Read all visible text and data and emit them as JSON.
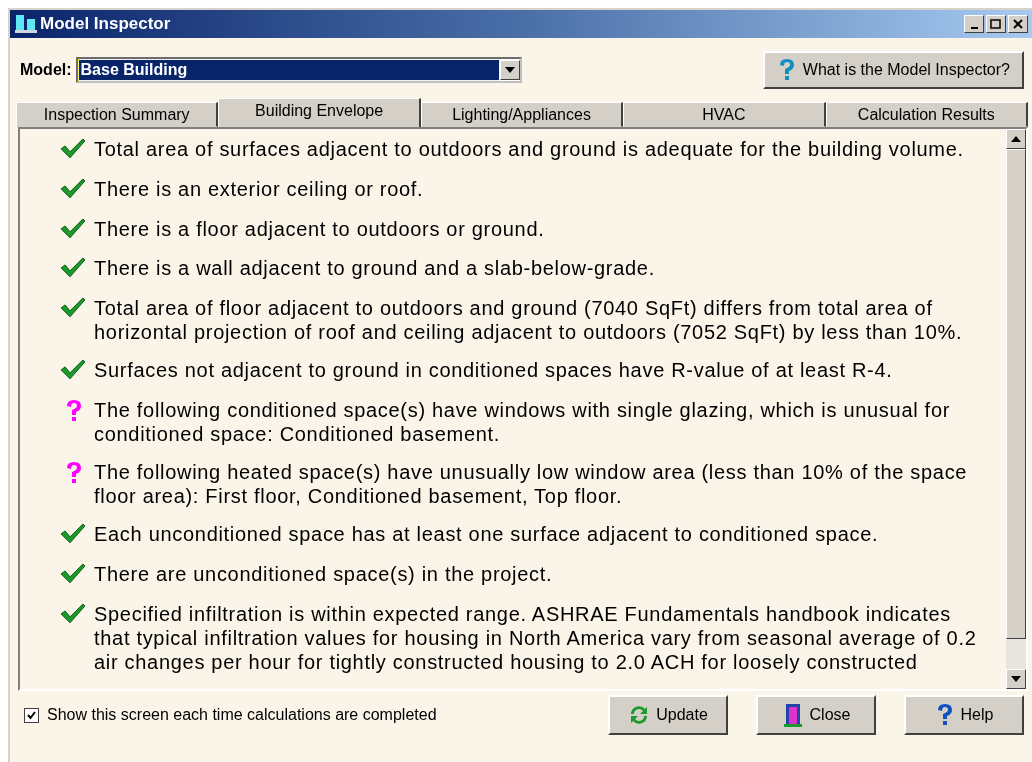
{
  "window": {
    "title": "Model Inspector"
  },
  "model": {
    "label": "Model:",
    "value": "Base Building"
  },
  "help_top_button": "What is the Model Inspector?",
  "tabs": [
    {
      "label": "Inspection Summary",
      "selected": false
    },
    {
      "label": "Building Envelope",
      "selected": true
    },
    {
      "label": "Lighting/Appliances",
      "selected": false
    },
    {
      "label": "HVAC",
      "selected": false
    },
    {
      "label": "Calculation Results",
      "selected": false
    }
  ],
  "findings": [
    {
      "kind": "pass",
      "text": "Total area of surfaces adjacent to outdoors and ground is adequate for the building volume."
    },
    {
      "kind": "pass",
      "text": "There is an exterior ceiling or roof."
    },
    {
      "kind": "pass",
      "text": "There is a floor adjacent to outdoors or ground."
    },
    {
      "kind": "pass",
      "text": "There is a wall adjacent to ground and a slab-below-grade."
    },
    {
      "kind": "pass",
      "text": "Total area of floor adjacent to outdoors and ground (7040 SqFt) differs from total area of horizontal projection of roof and ceiling adjacent to outdoors (7052 SqFt) by less than 10%."
    },
    {
      "kind": "pass",
      "text": "Surfaces not adjacent to ground in conditioned spaces have R-value of at least R-4."
    },
    {
      "kind": "question",
      "text": "The following conditioned space(s) have windows with single glazing, which is unusual for conditioned space: Conditioned basement."
    },
    {
      "kind": "question",
      "text": "The following heated space(s) have unusually low window area (less than 10% of the space floor area): First floor, Conditioned basement, Top floor."
    },
    {
      "kind": "pass",
      "text": "Each unconditioned space has at least one surface adjacent to conditioned space."
    },
    {
      "kind": "pass",
      "text": "There are unconditioned space(s) in the project."
    },
    {
      "kind": "pass",
      "text": "Specified infiltration is within expected range. ASHRAE Fundamentals handbook indicates that typical infiltration values for housing in North America vary from seasonal average of 0.2 air changes per hour for tightly constructed housing to 2.0 ACH for loosely constructed"
    }
  ],
  "show_each_time": {
    "label": "Show this screen each time calculations are completed",
    "checked": true
  },
  "buttons": [
    {
      "kind": "update",
      "label": "Update"
    },
    {
      "kind": "close",
      "label": "Close"
    },
    {
      "kind": "help",
      "label": "Help"
    }
  ]
}
